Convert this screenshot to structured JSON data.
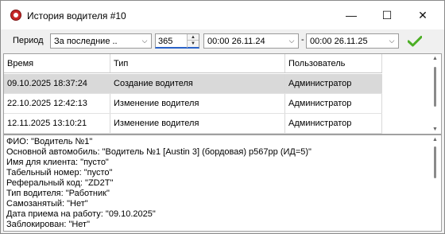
{
  "window": {
    "title": "История водителя #10",
    "minimize_glyph": "—",
    "maximize_glyph": "☐",
    "close_glyph": "✕",
    "icon": "app-record-icon"
  },
  "toolbar": {
    "period_label": "Период",
    "period_value": "За последние ..",
    "days_value": "365",
    "date_from": "00:00 26.11.24",
    "separator": "-",
    "date_to": "00:00 26.11.25",
    "apply_icon": "checkmark-icon",
    "apply_color": "#4caf25"
  },
  "grid": {
    "columns": [
      "Время",
      "Тип",
      "Пользователь"
    ],
    "rows": [
      {
        "time": "09.10.2025 18:37:24",
        "type": "Создание водителя",
        "user": "Администратор"
      },
      {
        "time": "22.10.2025 12:42:13",
        "type": "Изменение водителя",
        "user": "Администратор"
      },
      {
        "time": "12.11.2025 13:10:21",
        "type": "Изменение водителя",
        "user": "Администратор"
      }
    ],
    "selected_row": 0
  },
  "details": {
    "lines": [
      "ФИО: \"Водитель №1\"",
      "Основной автомобиль: \"Водитель №1 [Austin 3] (бордовая) р567рр (ИД=5)\"",
      "Имя для клиента: \"пусто\"",
      "Табельный номер: \"пусто\"",
      "Реферальный код: \"ZD2T\"",
      "Тип водителя: \"Работник\"",
      "Самозанятый: \"Нет\"",
      "Дата приема на работу: \"09.10.2025\"",
      "Заблокирован: \"Нет\""
    ]
  }
}
